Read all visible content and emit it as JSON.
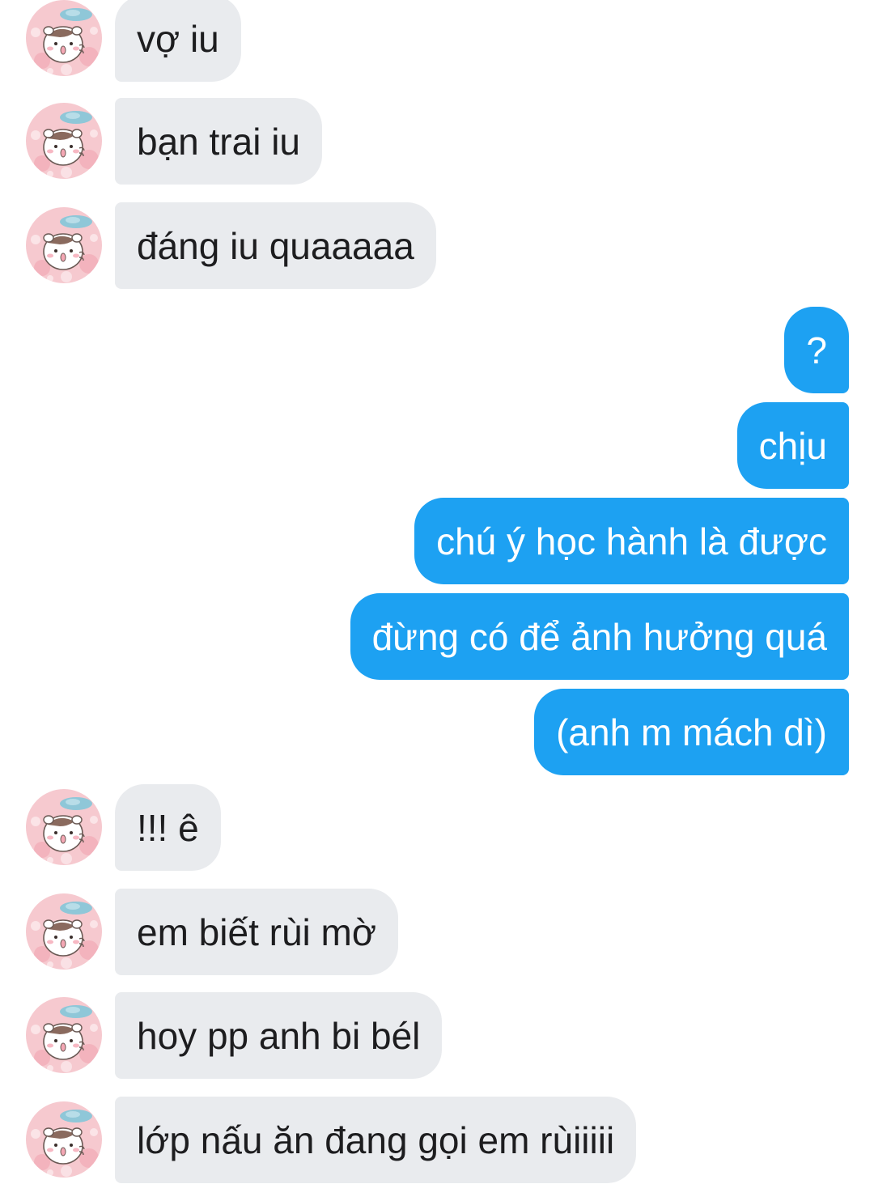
{
  "conversation": {
    "messages": [
      {
        "direction": "incoming",
        "text": "vợ iu"
      },
      {
        "direction": "incoming",
        "text": "bạn trai iu"
      },
      {
        "direction": "incoming",
        "text": "đáng iu quaaaaa"
      },
      {
        "direction": "outgoing",
        "text": "?"
      },
      {
        "direction": "outgoing",
        "text": "chịu"
      },
      {
        "direction": "outgoing",
        "text": "chú ý học hành là được"
      },
      {
        "direction": "outgoing",
        "text": "đừng có để ảnh hưởng quá"
      },
      {
        "direction": "outgoing",
        "text": "(anh m mách dì)"
      },
      {
        "direction": "incoming",
        "text": "!!! ê"
      },
      {
        "direction": "incoming",
        "text": "em biết rùi mờ"
      },
      {
        "direction": "incoming",
        "text": "hoy pp anh bi bél"
      },
      {
        "direction": "incoming",
        "text": "lớp nấu ăn đang gọi em rùiiiii"
      }
    ]
  },
  "contact": {
    "avatar_icon": "hamster-cartoon-avatar"
  },
  "colors": {
    "incoming_bubble": "#e9ebee",
    "outgoing_bubble": "#1da1f2",
    "incoming_text": "#1d1d1f",
    "outgoing_text": "#ffffff"
  }
}
